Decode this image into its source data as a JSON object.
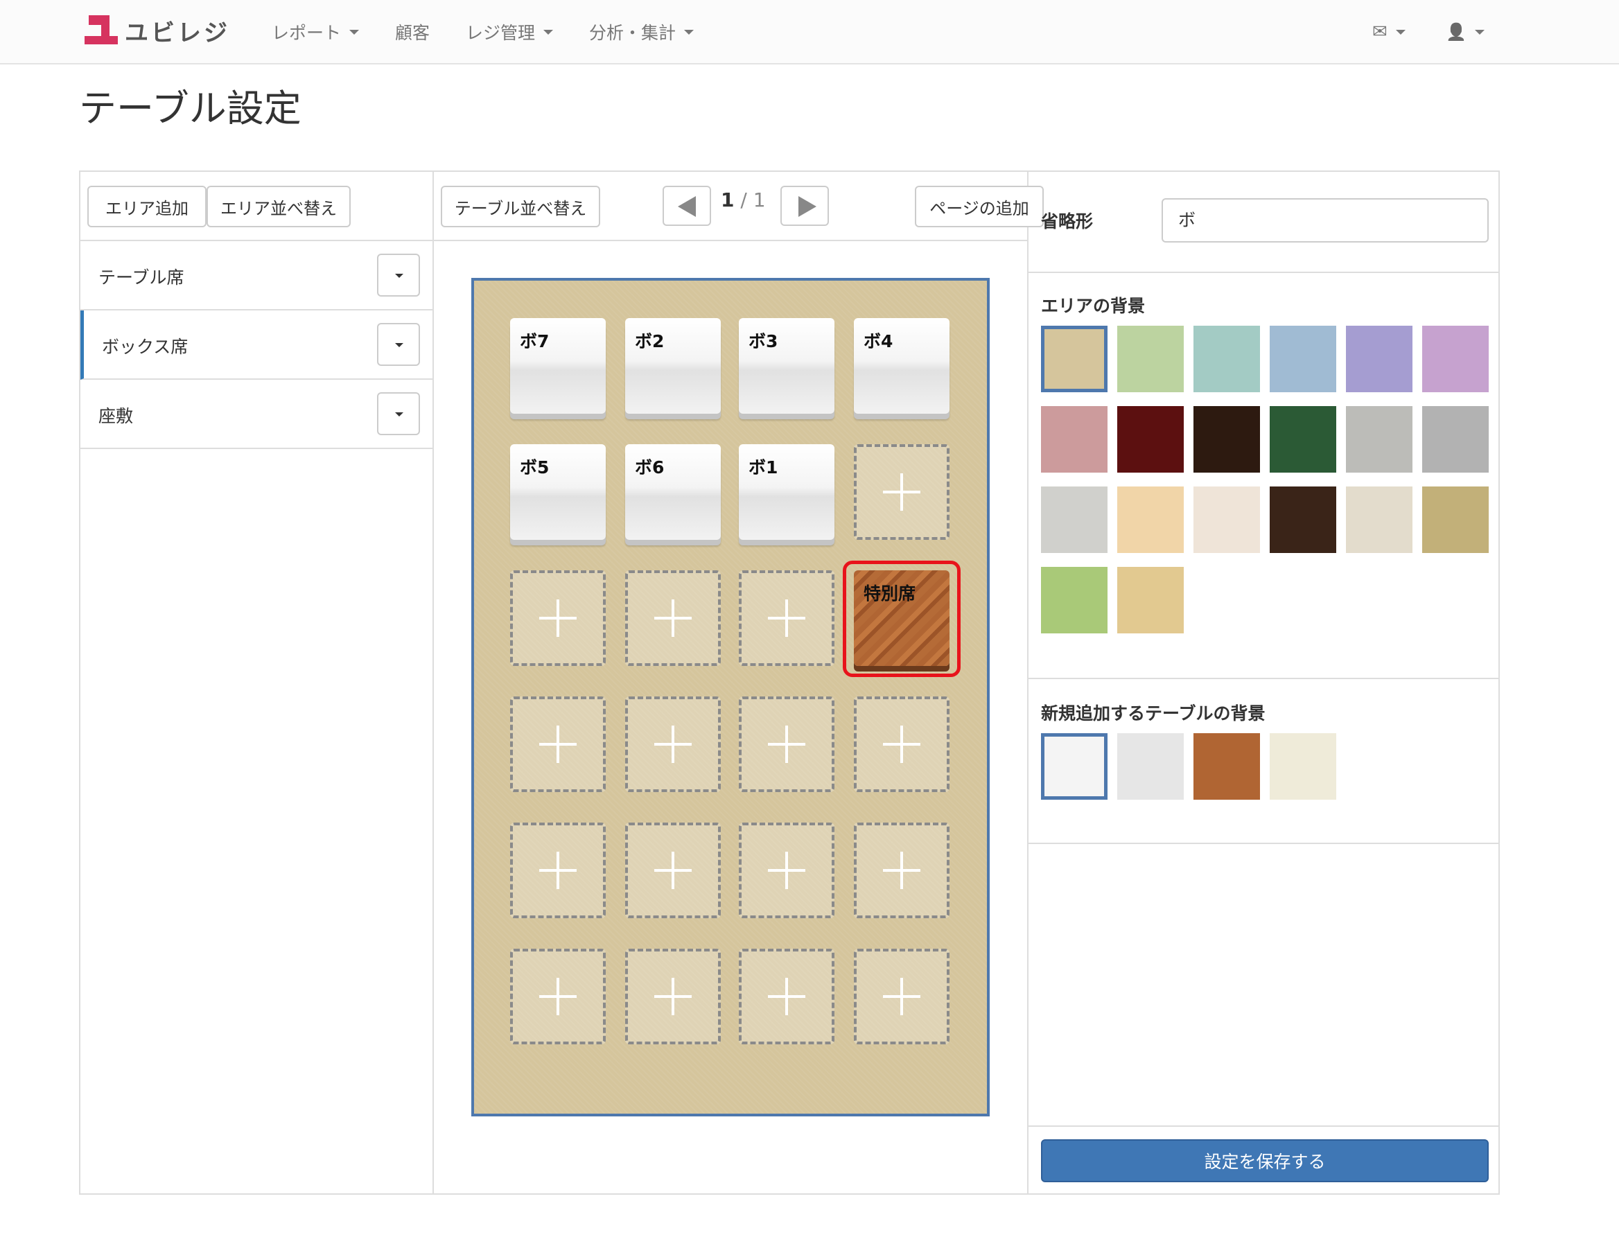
{
  "navbar": {
    "brand": "ユビレジ",
    "menu": [
      {
        "label": "レポート",
        "has_caret": true
      },
      {
        "label": "顧客",
        "has_caret": false
      },
      {
        "label": "レジ管理",
        "has_caret": true
      },
      {
        "label": "分析・集計",
        "has_caret": true
      }
    ],
    "mail_icon": "envelope-icon",
    "user_icon": "user-icon",
    "mail_glyph": "✉",
    "user_glyph": "👤"
  },
  "page": {
    "title": "テーブル設定"
  },
  "areas": {
    "add_button": "エリア追加",
    "sort_button": "エリア並べ替え",
    "items": [
      {
        "label": "テーブル席",
        "active": false
      },
      {
        "label": "ボックス席",
        "active": true
      },
      {
        "label": "座敷",
        "active": false
      }
    ]
  },
  "tables_toolbar": {
    "sort_button": "テーブル並べ替え",
    "current_page": "1",
    "page_separator": " / ",
    "total_pages": "1",
    "add_page_button": "ページの追加"
  },
  "floor": {
    "background": "#d5c59c",
    "border_color": "#4e78ad",
    "rows": [
      [
        {
          "type": "table",
          "name": "ボ7"
        },
        {
          "type": "table",
          "name": "ボ2"
        },
        {
          "type": "table",
          "name": "ボ3"
        },
        {
          "type": "table",
          "name": "ボ4"
        }
      ],
      [
        {
          "type": "table",
          "name": "ボ5"
        },
        {
          "type": "table",
          "name": "ボ6"
        },
        {
          "type": "table",
          "name": "ボ1"
        },
        {
          "type": "empty"
        }
      ],
      [
        {
          "type": "empty"
        },
        {
          "type": "empty"
        },
        {
          "type": "empty"
        },
        {
          "type": "wood",
          "name": "特別席",
          "selected": true
        }
      ],
      [
        {
          "type": "empty"
        },
        {
          "type": "empty"
        },
        {
          "type": "empty"
        },
        {
          "type": "empty"
        }
      ],
      [
        {
          "type": "empty"
        },
        {
          "type": "empty"
        },
        {
          "type": "empty"
        },
        {
          "type": "empty"
        }
      ],
      [
        {
          "type": "empty"
        },
        {
          "type": "empty"
        },
        {
          "type": "empty"
        },
        {
          "type": "empty"
        }
      ]
    ]
  },
  "settings": {
    "abbrev_label": "省略形",
    "abbrev_value": "ボ",
    "area_bg_label": "エリアの背景",
    "area_bg_swatches": [
      {
        "color": "#d5c59c",
        "selected": true
      },
      {
        "color": "#bcd3a0"
      },
      {
        "color": "#a3cbc4"
      },
      {
        "color": "#a0bbd3"
      },
      {
        "color": "#a59dd1"
      },
      {
        "color": "#c6a2cf"
      },
      {
        "color": "#cc9b9c"
      },
      {
        "color": "#5c1010"
      },
      {
        "color": "#2d1a10"
      },
      {
        "color": "#2b5a35"
      },
      {
        "color": "#bcbcb8"
      },
      {
        "color": "#b2b2b2"
      },
      {
        "color": "#d0d0cc"
      },
      {
        "color": "#f1d5a8"
      },
      {
        "color": "#efe4d8"
      },
      {
        "color": "#3a2418"
      },
      {
        "color": "#e3dccc"
      },
      {
        "color": "#c2b079"
      },
      {
        "color": "#a9c978"
      },
      {
        "color": "#e2c990"
      }
    ],
    "table_bg_label": "新規追加するテーブルの背景",
    "table_bg_swatches": [
      {
        "color": "#f4f4f4",
        "selected": true
      },
      {
        "color": "#e6e6e6"
      },
      {
        "color": "#b06533"
      },
      {
        "color": "#efebd9"
      }
    ],
    "save_button": "設定を保存する"
  }
}
